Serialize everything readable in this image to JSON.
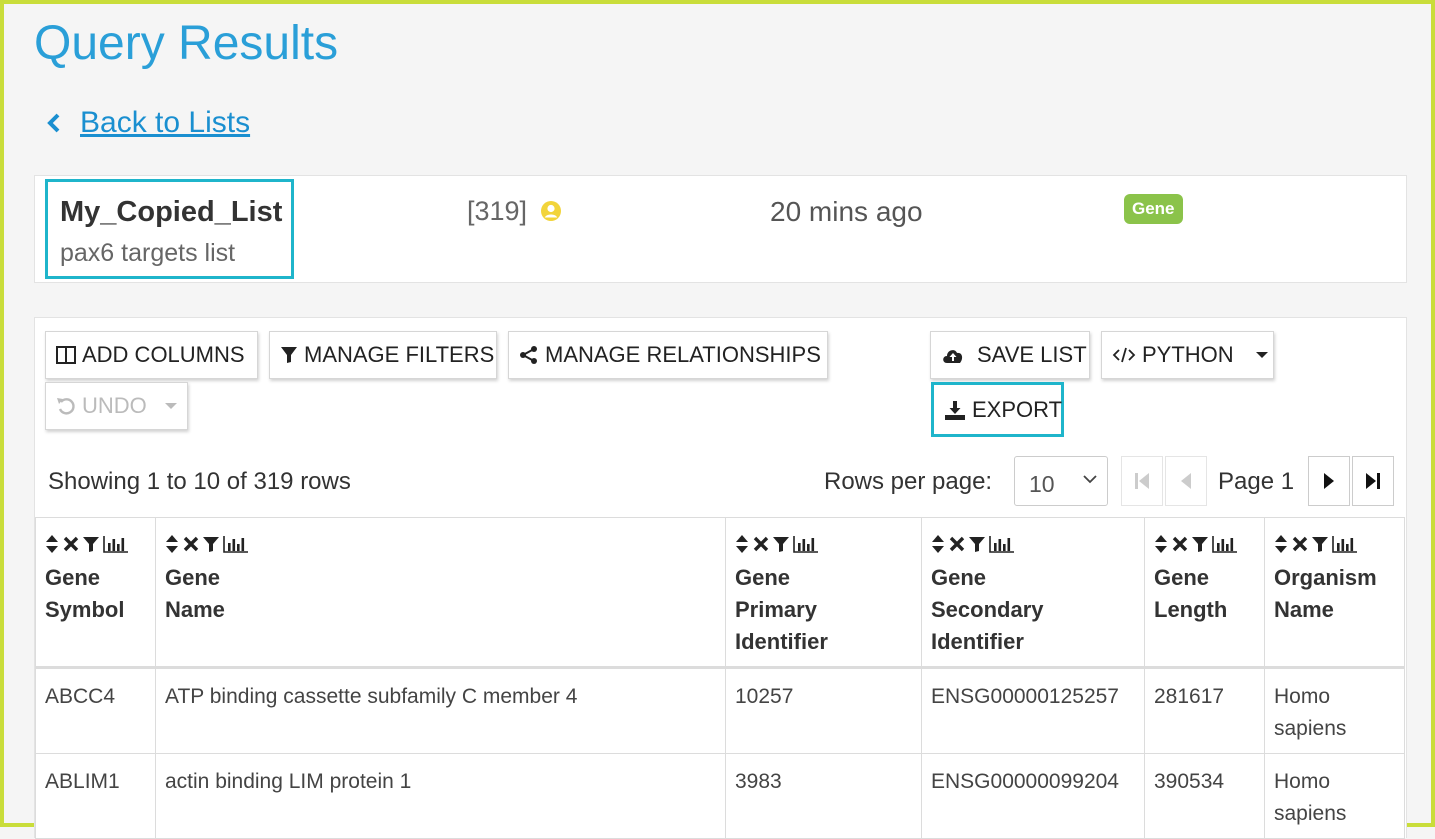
{
  "page": {
    "title": "Query Results",
    "back_label": "Back to Lists"
  },
  "list": {
    "name": "My_Copied_List",
    "description": "pax6 targets list",
    "count": "[319]",
    "time": "20 mins ago",
    "type": "Gene"
  },
  "toolbar": {
    "add_columns": "ADD COLUMNS",
    "manage_filters": "MANAGE FILTERS",
    "manage_relationships": "MANAGE RELATIONSHIPS",
    "save_list": "SAVE LIST",
    "python": "PYTHON",
    "undo": "UNDO",
    "export": "EXPORT"
  },
  "pagination": {
    "showing": "Showing 1 to 10 of 319 rows",
    "rows_per_page_label": "Rows per page:",
    "rows_per_page_value": "10",
    "page_label": "Page 1"
  },
  "table": {
    "columns": [
      {
        "line1": "Gene",
        "line2": "Symbol",
        "line3": ""
      },
      {
        "line1": "Gene",
        "line2": "Name",
        "line3": ""
      },
      {
        "line1": "Gene",
        "line2": "Primary",
        "line3": "Identifier"
      },
      {
        "line1": "Gene",
        "line2": "Secondary",
        "line3": "Identifier"
      },
      {
        "line1": "Gene",
        "line2": "Length",
        "line3": ""
      },
      {
        "line1": "Organism",
        "line2": "Name",
        "line3": ""
      }
    ],
    "rows": [
      {
        "symbol": "ABCC4",
        "name": "ATP binding cassette subfamily C member 4",
        "primary": "10257",
        "secondary": "ENSG00000125257",
        "length": "281617",
        "organism_1": "Homo",
        "organism_2": "sapiens"
      },
      {
        "symbol": "ABLIM1",
        "name": "actin binding LIM protein 1",
        "primary": "3983",
        "secondary": "ENSG00000099204",
        "length": "390534",
        "organism_1": "Homo",
        "organism_2": "sapiens"
      }
    ]
  },
  "colors": {
    "accent": "#2a9fd8",
    "highlight": "#1fb5cb",
    "badge": "#8bc34a",
    "frame": "#c9dd3a"
  }
}
